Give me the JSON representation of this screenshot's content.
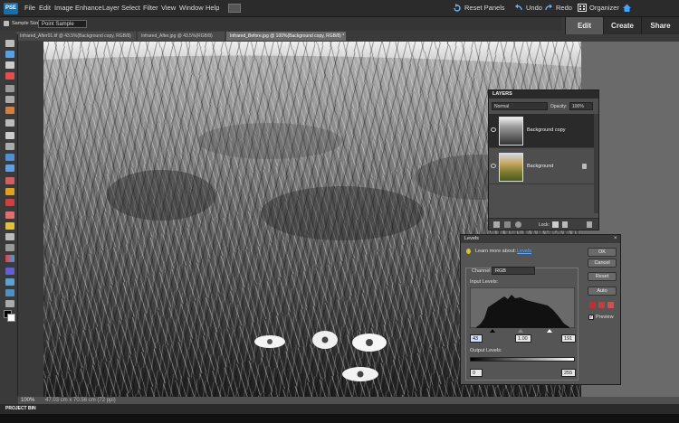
{
  "app": {
    "logo": "PSE"
  },
  "menu": [
    "File",
    "Edit",
    "Image",
    "Enhance",
    "Layer",
    "Select",
    "Filter",
    "View",
    "Window",
    "Help"
  ],
  "header": {
    "reset_panels": "Reset Panels",
    "undo": "Undo",
    "redo": "Redo",
    "organizer": "Organizer"
  },
  "modes": [
    "Edit",
    "Create",
    "Share"
  ],
  "options": {
    "sample_size_label": "Sample Size:",
    "sample_size_value": "Point Sample"
  },
  "doc_tabs": [
    "Infrared_After01.tif @ 43.5%(Background copy, RGB/8)",
    "Infrared_After.jpg @ 43.5%(RGB/8)",
    "Infrared_Before.jpg @ 100%(Background copy, RGB/8) *"
  ],
  "status": {
    "zoom": "100%",
    "dims": "47.03 cm x 70.56 cm (72 ppi)"
  },
  "project_bin": "PROJECT BIN",
  "layers_panel": {
    "title": "LAYERS",
    "blend_mode": "Normal",
    "opacity_label": "Opacity:",
    "opacity_value": "100%",
    "layers": [
      "Background copy",
      "Background"
    ],
    "lock_label": "Lock:"
  },
  "levels": {
    "title": "Levels",
    "learn_more": "Learn more about:",
    "learn_more_link": "Levels",
    "channel_label": "Channel:",
    "channel_value": "RGB",
    "input_levels_label": "Input Levels:",
    "input_black": "43",
    "input_gamma": "1.00",
    "input_white": "191",
    "output_levels_label": "Output Levels:",
    "output_black": "0",
    "output_white": "255",
    "buttons": {
      "ok": "OK",
      "cancel": "Cancel",
      "reset": "Reset",
      "auto": "Auto"
    },
    "preview_label": "Preview"
  }
}
